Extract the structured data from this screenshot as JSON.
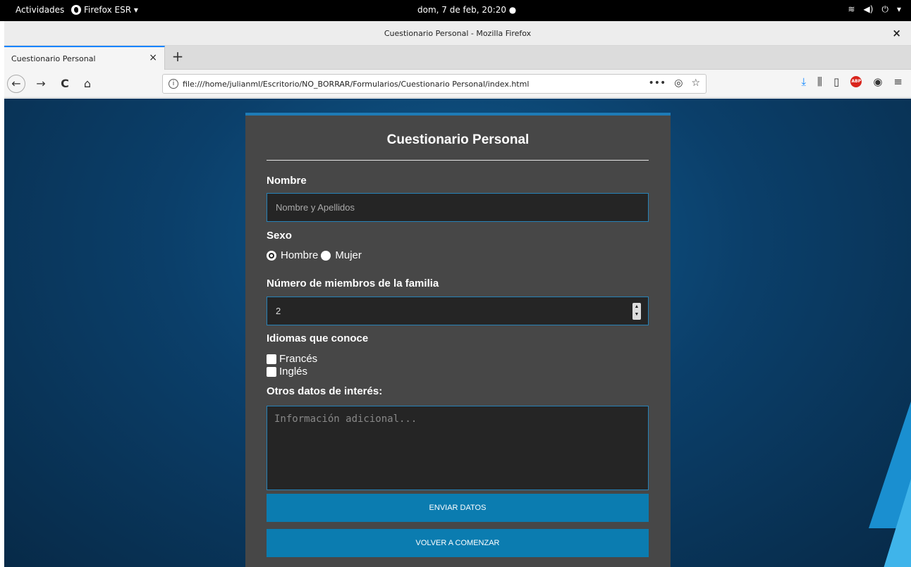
{
  "system_bar": {
    "activities": "Actividades",
    "app_name": "Firefox ESR ▾",
    "clock": "dom, 7 de feb, 20:20 ●",
    "tray": [
      "wifi-icon",
      "volume-icon",
      "power-icon",
      "chevron-down-icon"
    ]
  },
  "window": {
    "title": "Cuestionario Personal - Mozilla Firefox",
    "close": "×"
  },
  "tabs": [
    {
      "label": "Cuestionario Personal",
      "close": "×"
    }
  ],
  "new_tab": "+",
  "nav": {
    "url": "file:///home/julianml/Escritorio/NO_BORRAR/Formularios/Cuestionario Personal/index.html",
    "page_actions": "•••"
  },
  "form": {
    "title": "Cuestionario Personal",
    "name_label": "Nombre",
    "name_placeholder": "Nombre y Apellidos",
    "sex_label": "Sexo",
    "sex_options": [
      {
        "label": "Hombre",
        "selected": true
      },
      {
        "label": "Mujer",
        "selected": false
      }
    ],
    "family_label": "Número de miembros de la familia",
    "family_value": "2",
    "languages_label": "Idiomas que conoce",
    "languages": [
      {
        "label": "Francés",
        "checked": false
      },
      {
        "label": "Inglés",
        "checked": false
      }
    ],
    "other_label": "Otros datos de interés:",
    "other_placeholder": "Información adicional...",
    "submit_label": "ENVIAR DATOS",
    "reset_label": "VOLVER A COMENZAR"
  },
  "colors": {
    "accent": "#0b7cb0",
    "card_bg": "#474747",
    "field_border": "#2782b8"
  }
}
